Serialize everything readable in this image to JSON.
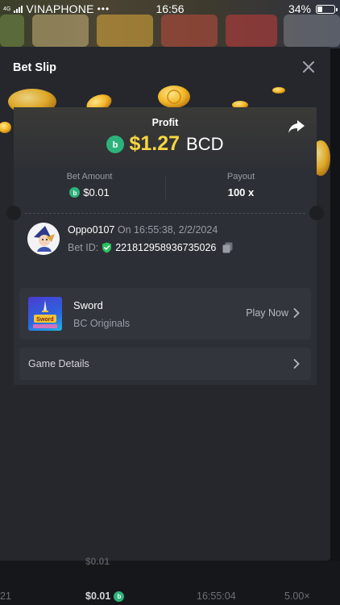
{
  "status_bar": {
    "network": "4G",
    "carrier": "VINAPHONE",
    "time": "16:56",
    "battery": "34%",
    "battery_level": 0.34
  },
  "modal": {
    "title": "Bet Slip",
    "profit_label": "Profit",
    "profit_value": "$1.27",
    "profit_currency": "BCD",
    "bet_amount_label": "Bet Amount",
    "bet_amount_value": "$0.01",
    "payout_label": "Payout",
    "payout_value": "100 x",
    "player_name": "Oppo0107",
    "bet_date": "On 16:55:38, 2/2/2024",
    "bet_id_label": "Bet ID:",
    "bet_id_value": "221812958936735026",
    "game": {
      "name": "Sword",
      "provider": "BC Originals",
      "play_label": "Play Now",
      "thumb_text": "Sword"
    },
    "details_label": "Game Details"
  },
  "bottom_row": {
    "faded_amount": "$0.01",
    "rank": "21",
    "amount": "$0.01",
    "time": "16:55:04",
    "multiplier": "5.00×"
  },
  "colors": {
    "profit_gold": "#f7d640",
    "bcd_green": "#2db37a",
    "modal_bg": "#25272d"
  }
}
